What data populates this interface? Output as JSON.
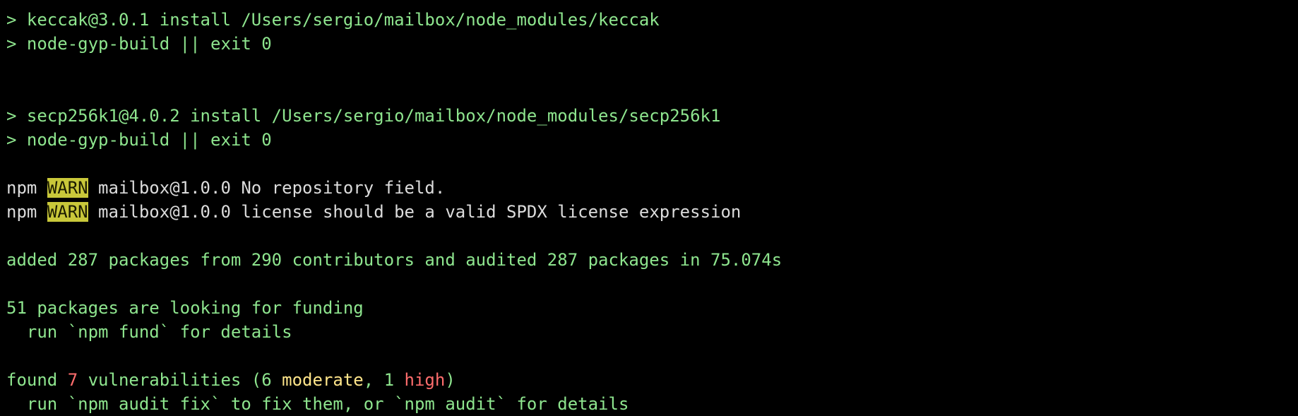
{
  "terminal": {
    "lines": [
      {
        "prompt": ">",
        "text": " keccak@3.0.1 install /Users/sergio/mailbox/node_modules/keccak"
      },
      {
        "prompt": ">",
        "text": " node-gyp-build || exit 0"
      },
      {
        "blank": true
      },
      {
        "blank": true
      },
      {
        "prompt": ">",
        "text": " secp256k1@4.0.2 install /Users/sergio/mailbox/node_modules/secp256k1"
      },
      {
        "prompt": ">",
        "text": " node-gyp-build || exit 0"
      },
      {
        "blank": true
      },
      {
        "npm": "npm",
        "warn": "WARN",
        "msg": " mailbox@1.0.0 No repository field."
      },
      {
        "npm": "npm",
        "warn": "WARN",
        "msg": " mailbox@1.0.0 license should be a valid SPDX license expression"
      },
      {
        "blank": true
      },
      {
        "text": "added 287 packages from 290 contributors and audited 287 packages in 75.074s"
      },
      {
        "blank": true
      },
      {
        "text": "51 packages are looking for funding"
      },
      {
        "text": "  run `npm fund` for details"
      },
      {
        "blank": true
      },
      {
        "found_prefix": "found ",
        "vuln_count": "7",
        "vuln_mid": " vulnerabilities (6 ",
        "moderate": "moderate",
        "sep": ", 1 ",
        "high": "high",
        "close": ")"
      },
      {
        "text": "  run `npm audit fix` to fix them, or `npm audit` for details"
      }
    ]
  },
  "colors": {
    "background": "#000000",
    "text": "#8ee58e",
    "warn_bg": "#c9c83a",
    "red": "#ff6d6d",
    "yellow": "#ffe58a"
  }
}
